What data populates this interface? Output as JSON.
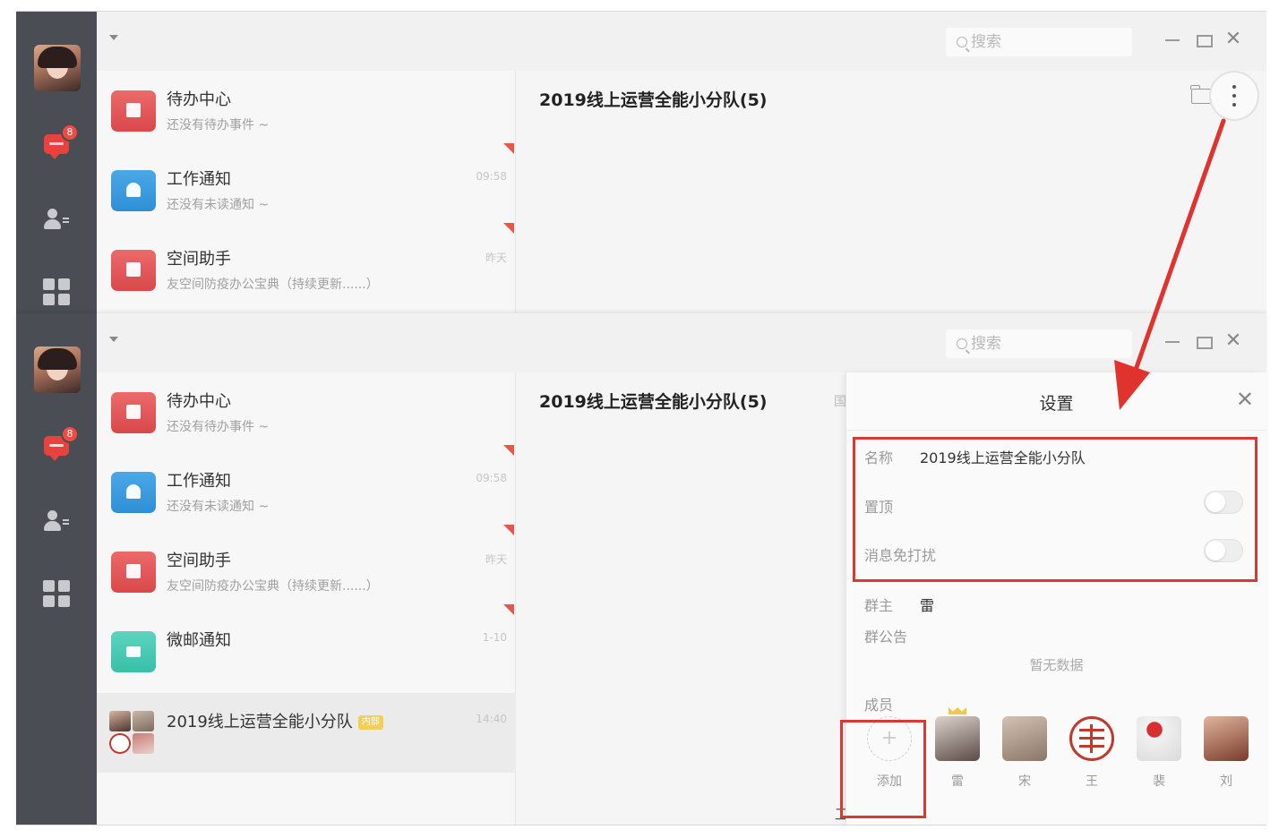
{
  "search": {
    "placeholder": "搜索"
  },
  "sidebar": {
    "badge": "8"
  },
  "top": {
    "conversations": [
      {
        "title": "待办中心",
        "subtitle": "还没有待办事件 ~",
        "time": ""
      },
      {
        "title": "工作通知",
        "subtitle": "还没有未读通知 ~",
        "time": "09:58"
      },
      {
        "title": "空间助手",
        "subtitle": "友空间防疫办公宝典（持续更新......）",
        "time": "昨天"
      }
    ],
    "chat_title": "2019线上运营全能小分队(5)"
  },
  "bottom": {
    "conversations": [
      {
        "title": "待办中心",
        "subtitle": "还没有待办事件 ~",
        "time": ""
      },
      {
        "title": "工作通知",
        "subtitle": "还没有未读通知 ~",
        "time": "09:58"
      },
      {
        "title": "空间助手",
        "subtitle": "友空间防疫办公宝典（持续更新......）",
        "time": "昨天"
      },
      {
        "title": "微邮通知",
        "subtitle": "",
        "time": "1-10"
      },
      {
        "title": "2019线上运营全能小分队",
        "tag": "内部",
        "subtitle": "",
        "time": "14:40"
      }
    ],
    "chat_title": "2019线上运营全能小分队(5)",
    "chat_edge_text": "国",
    "chat_edge_bottom": "工"
  },
  "settings": {
    "title": "设置",
    "name_label": "名称",
    "name_value": "2019线上运营全能小分队",
    "pin_label": "置顶",
    "pin_on": false,
    "mute_label": "消息免打扰",
    "mute_on": false,
    "owner_label": "群主",
    "owner_value": "雷",
    "notice_label": "群公告",
    "notice_empty": "暂无数据",
    "members_label": "成员",
    "add_label": "添加",
    "members": [
      {
        "name": "雷",
        "owner": true
      },
      {
        "name": "宋"
      },
      {
        "name": "王"
      },
      {
        "name": "裴"
      },
      {
        "name": "刘"
      }
    ]
  },
  "colors": {
    "accent_red": "#d63a35",
    "sidebar": "#4a4d53"
  }
}
